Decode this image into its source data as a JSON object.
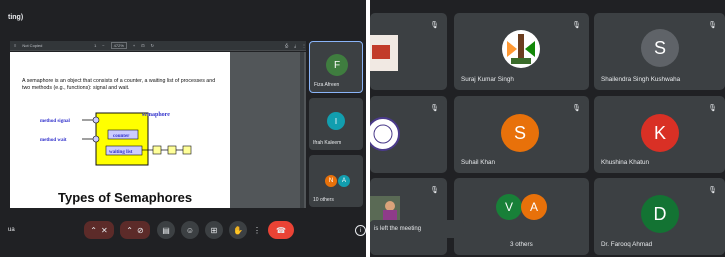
{
  "left_pane": {
    "window_title_fragment": "ting)",
    "pdf_toolbar": {
      "filename": "Not Copied",
      "zoom": "472%",
      "page_indicator": "1"
    },
    "slide": {
      "text_line_1": "A semaphore is an object that consists of a counter, a waiting list of processes and",
      "text_line_2": "two methods (e.g., functions): signal and wait.",
      "diagram": {
        "semaphore_label": "semaphore",
        "method_signal_label": "method signal",
        "method_wait_label": "method wait",
        "counter_label": "counter",
        "waiting_list_label": "waiting list"
      },
      "heading": "Types of Semaphores"
    },
    "side_participants": [
      {
        "name": "Fiza Afreen",
        "initial": "F",
        "color": "#3f7d3f",
        "active": true
      },
      {
        "name": "Ifrah Kaleem",
        "initial": "I",
        "color": "#129eaf",
        "active": false
      },
      {
        "name": "10 others",
        "initials": [
          "N",
          "A"
        ],
        "colors": [
          "#e8710a",
          "#129eaf"
        ],
        "active": false
      }
    ],
    "bottom_bar": {
      "self_name_fragment": "ua",
      "info_glyph": "i"
    }
  },
  "right_pane": {
    "tiles": [
      {
        "name": "",
        "type": "image",
        "muted": true
      },
      {
        "name": "Suraj Kumar Singh",
        "type": "image",
        "muted": true
      },
      {
        "name": "Shailendra Singh Kushwaha",
        "initial": "S",
        "color": "#5f6368",
        "muted": true
      },
      {
        "name": "",
        "type": "image",
        "muted": true
      },
      {
        "name": "Suhail Khan",
        "initial": "S",
        "color": "#e8710a",
        "muted": true
      },
      {
        "name": "Khushina Khatun",
        "initial": "K",
        "color": "#d93025",
        "muted": true
      },
      {
        "name": "",
        "type": "image",
        "muted": true
      },
      {
        "name": "3 others",
        "initials": [
          "V",
          "A"
        ],
        "colors": [
          "#188038",
          "#e8710a"
        ],
        "muted": false
      },
      {
        "name": "Dr. Farooq Ahmad",
        "initial": "D",
        "color": "#137333",
        "muted": true
      }
    ],
    "toast": "is left the meeting"
  }
}
